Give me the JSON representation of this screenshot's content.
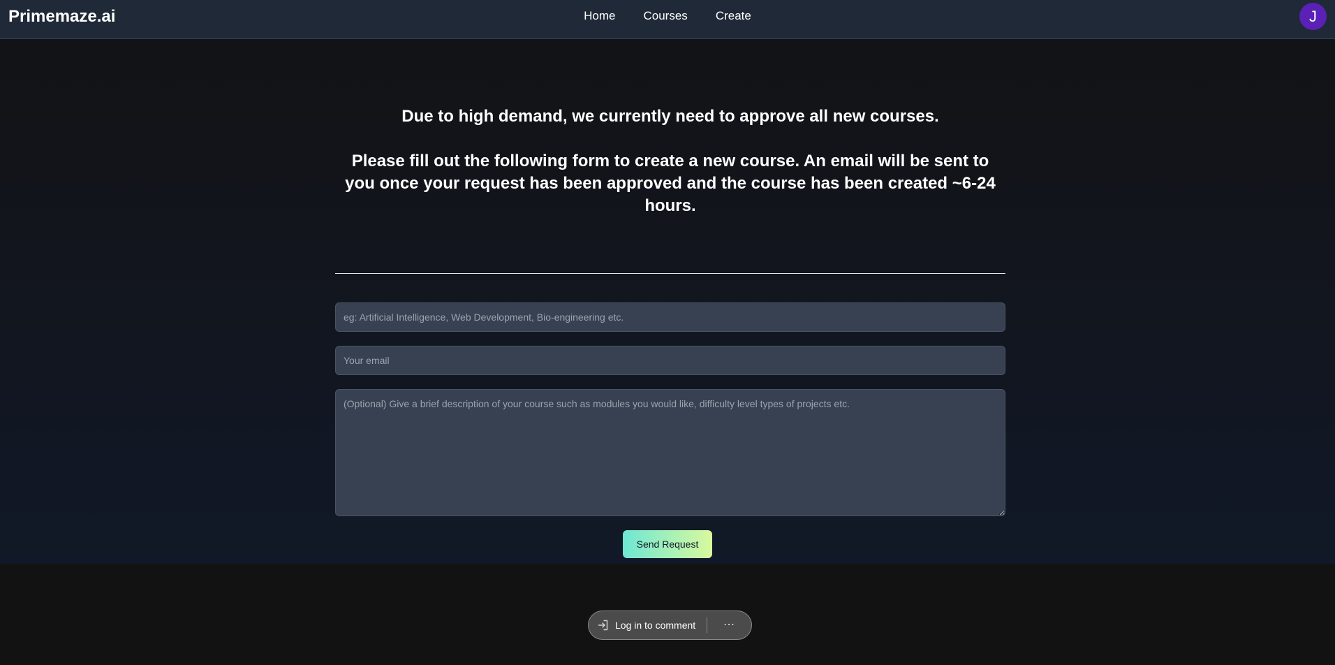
{
  "header": {
    "brand": "Primemaze.ai",
    "nav": [
      {
        "label": "Home"
      },
      {
        "label": "Courses"
      },
      {
        "label": "Create"
      }
    ],
    "avatar_initial": "J",
    "avatar_color": "#5b21b6"
  },
  "main": {
    "headline": "Due to high demand, we currently need to approve all new courses.",
    "subheadline": "Please fill out the following form to create a new course. An email will be sent to you once your request has been approved and the course has been created ~6-24 hours.",
    "form": {
      "topic_placeholder": "eg: Artificial Intelligence, Web Development, Bio-engineering etc.",
      "topic_value": "",
      "email_placeholder": "Your email",
      "email_value": "",
      "description_placeholder": "(Optional) Give a brief description of your course such as modules you would like, difficulty level types of projects etc.",
      "description_value": "",
      "submit_label": "Send Request"
    }
  },
  "comment_bar": {
    "login_label": "Log in to comment",
    "more_label": "···",
    "login_icon": "login-icon",
    "more_icon": "more-icon"
  },
  "colors": {
    "accent_gradient_start": "#6ee7d4",
    "accent_gradient_end": "#d9f99d",
    "field_bg": "#374151",
    "header_bg": "#1f2937"
  }
}
